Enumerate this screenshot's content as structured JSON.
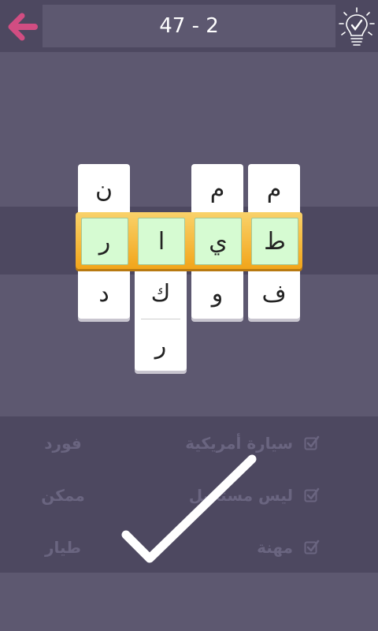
{
  "header": {
    "level": "47 - 2",
    "back_icon": "back-arrow-icon",
    "hint_icon": "lightbulb-check-icon",
    "accent": "#d14d82"
  },
  "grid": {
    "columns": [
      {
        "top": "ن",
        "answer": "ر",
        "bottom": [
          "د"
        ]
      },
      {
        "top": "",
        "answer": "ا",
        "bottom": [
          "ك",
          "ر"
        ]
      },
      {
        "top": "م",
        "answer": "ي",
        "bottom": [
          "و"
        ]
      },
      {
        "top": "م",
        "answer": "ط",
        "bottom": [
          "ف"
        ]
      }
    ],
    "answer_color": "#d6fbd2",
    "highlight_color": "#f5b830"
  },
  "clues": [
    {
      "text": "سيارة أمريكية",
      "answer": "فورد",
      "checked": true
    },
    {
      "text": "ليس مستحيل",
      "answer": "ممكن",
      "checked": true
    },
    {
      "text": "مهنة",
      "answer": "طيار",
      "checked": true
    }
  ],
  "status": {
    "solved": true,
    "icon": "big-checkmark-icon"
  }
}
